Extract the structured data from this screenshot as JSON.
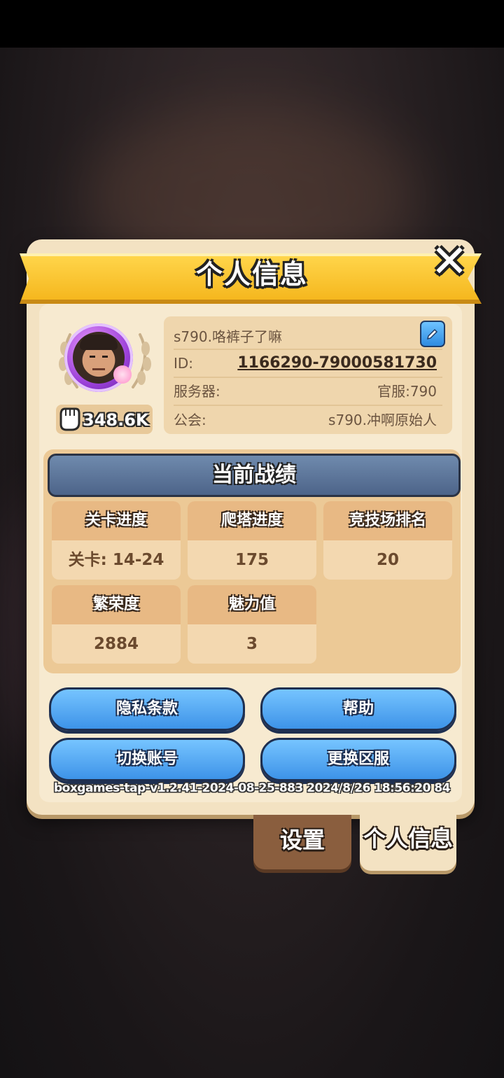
{
  "window": {
    "title": "个人信息"
  },
  "profile": {
    "name": "s790.咯裤子了嘛",
    "id_label": "ID:",
    "id_value": "1166290-79000581730",
    "server_label": "服务器:",
    "server_value": "官服:790",
    "guild_label": "公会:",
    "guild_value": "s790.冲啊原始人",
    "power": "348.6K"
  },
  "stats": {
    "title": "当前战绩",
    "items": [
      {
        "label": "关卡进度",
        "value": "关卡: 14-24"
      },
      {
        "label": "爬塔进度",
        "value": "175"
      },
      {
        "label": "竞技场排名",
        "value": "20"
      },
      {
        "label": "繁荣度",
        "value": "2884"
      },
      {
        "label": "魅力值",
        "value": "3"
      }
    ]
  },
  "buttons": {
    "privacy": "隐私条款",
    "help": "帮助",
    "switch_account": "切换账号",
    "change_server": "更换区服"
  },
  "version": "boxgames-tap-v1.2.41-2024-08-25-883 2024/8/26 18:56:20 84",
  "tabs": {
    "settings": "设置",
    "profile": "个人信息"
  },
  "icons": {
    "close": "close-icon",
    "edit": "pencil-icon",
    "power": "fist-icon"
  },
  "colors": {
    "banner": "#f5b71e",
    "button_blue": "#3d93e8",
    "panel": "#f3e2c2"
  }
}
